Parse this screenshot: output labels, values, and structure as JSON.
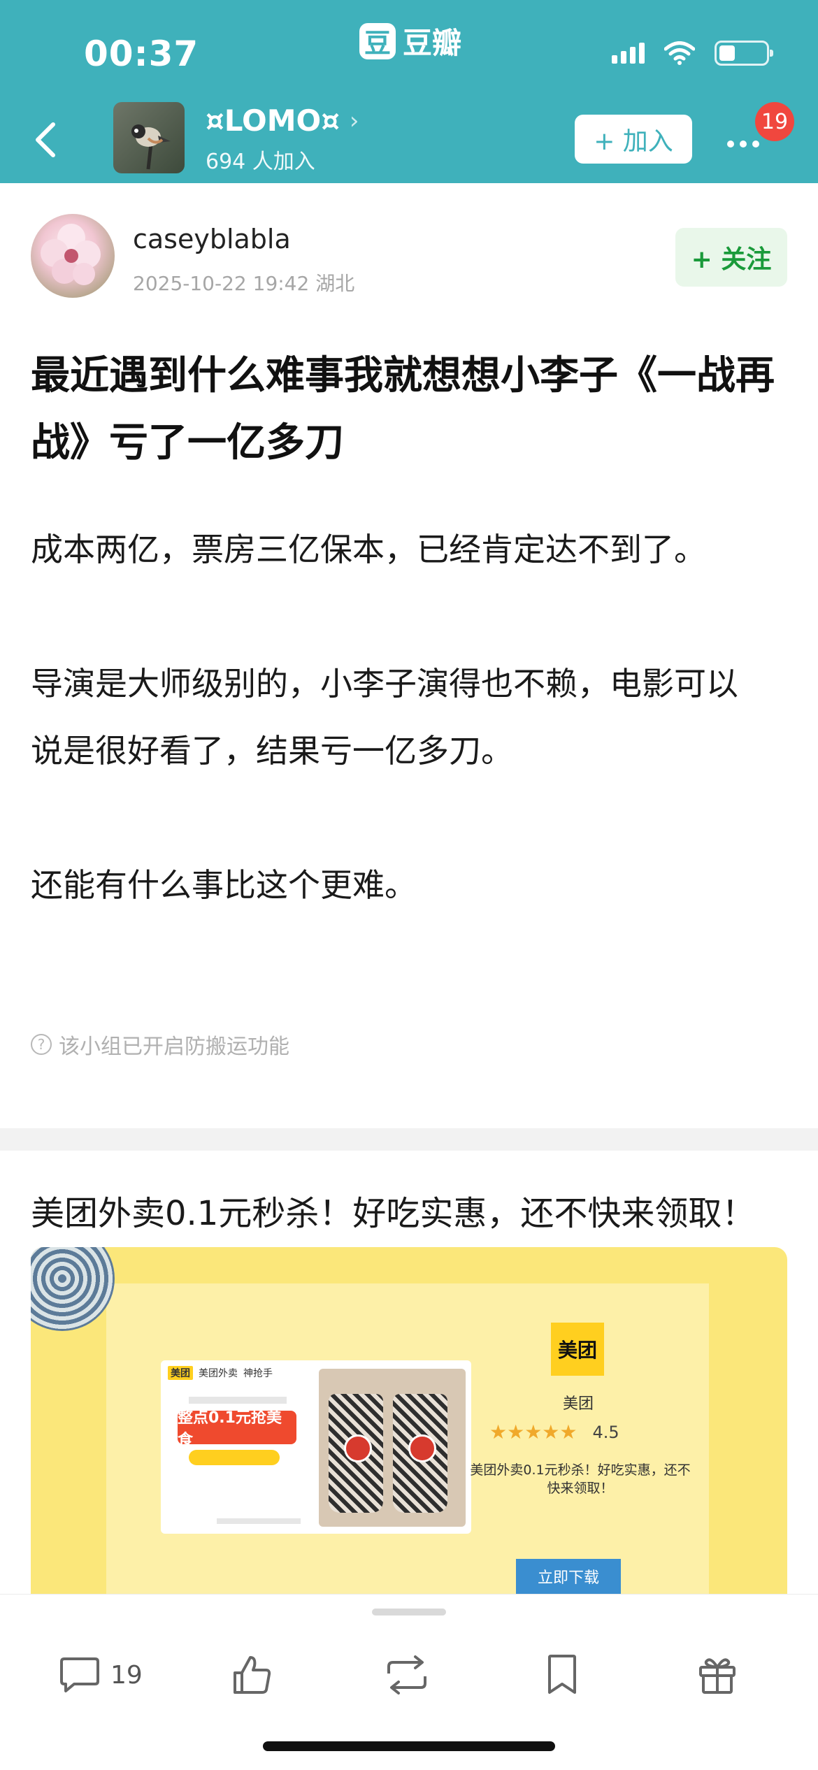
{
  "status_bar": {
    "time": "00:37"
  },
  "app": {
    "logo_char": "豆",
    "name": "豆瓣"
  },
  "group": {
    "name": "¤LOMO¤",
    "chevron": "›",
    "members": "694 人加入",
    "join_label": "+ 加入",
    "notification_count": "19"
  },
  "author": {
    "name": "caseyblabla",
    "meta": "2025-10-22 19:42  湖北",
    "follow_label": "+ 关注"
  },
  "post": {
    "title": "最近遇到什么难事我就想想小李子《一战再战》亏了一亿多刀",
    "paragraphs": [
      "成本两亿，票房三亿保本，已经肯定达不到了。",
      "导演是大师级别的，小李子演得也不赖，电影可以说是很好看了，结果亏一亿多刀。",
      "还能有什么事比这个更难。"
    ],
    "notice_icon": "?",
    "notice": "该小组已开启防搬运功能"
  },
  "ad": {
    "title": "美团外卖0.1元秒杀！好吃实惠，还不快来领取！",
    "poster_brand_1": "美团",
    "poster_brand_2": "美团外卖",
    "poster_brand_3": "神抢手",
    "poster_deal": "整点0.1元抢美食",
    "logo_text": "美团",
    "brand": "美团",
    "stars": "★★★★★",
    "rating": "4.5",
    "description": "美团外卖0.1元秒杀！好吃实惠，还不快来领取！",
    "download_label": "立即下载"
  },
  "bottom_bar": {
    "comment_count": "19",
    "icons": [
      "comment-icon",
      "like-icon",
      "repost-icon",
      "bookmark-icon",
      "gift-icon"
    ]
  },
  "colors": {
    "header_teal": "#3fb1bb",
    "follow_green": "#1a9a3a",
    "badge_red": "#f0473e",
    "ad_yellow": "#fbe77a"
  }
}
